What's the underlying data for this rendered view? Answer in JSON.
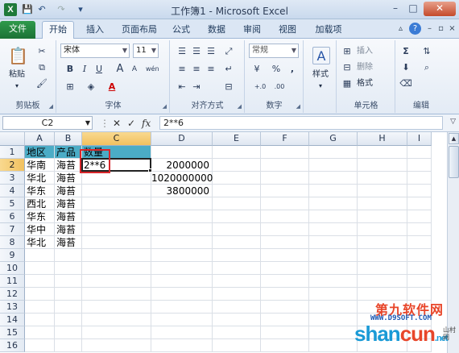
{
  "window": {
    "title": "工作簿1 - Microsoft Excel",
    "app_icon": "X",
    "qat_icons": [
      "save-icon",
      "undo-icon",
      "redo-icon",
      "customize-icon"
    ],
    "controls": [
      "–",
      "□",
      "✕"
    ]
  },
  "tabs": [
    {
      "label": "文件",
      "kind": "file"
    },
    {
      "label": "开始",
      "kind": "active"
    },
    {
      "label": "插入"
    },
    {
      "label": "页面布局"
    },
    {
      "label": "公式"
    },
    {
      "label": "数据"
    },
    {
      "label": "审阅"
    },
    {
      "label": "视图"
    },
    {
      "label": "加载项"
    }
  ],
  "ribbon": {
    "clipboard": {
      "label": "剪贴板",
      "paste": "粘贴"
    },
    "font": {
      "label": "字体",
      "font_name": "宋体",
      "font_size": "11",
      "bold": "B",
      "italic": "I",
      "underline": "U",
      "font_color": "A",
      "size_up": "A",
      "size_down": "A",
      "wen": "wén"
    },
    "alignment": {
      "label": "对齐方式"
    },
    "number": {
      "label": "数字",
      "format": "常规",
      "percent": "%",
      "comma": ","
    },
    "styles": {
      "label": "样式",
      "button": "样式"
    },
    "cells": {
      "label": "单元格",
      "insert": "插入",
      "delete": "删除",
      "format": "格式"
    },
    "editing": {
      "label": "编辑",
      "sigma": "Σ"
    }
  },
  "formula_bar": {
    "name_box": "C2",
    "cancel": "✕",
    "enter": "✓",
    "fx": "fx",
    "content": "2**6"
  },
  "grid": {
    "columns": [
      "A",
      "B",
      "C",
      "D",
      "E",
      "F",
      "G",
      "H",
      "I"
    ],
    "selected_column": "C",
    "rows": [
      "1",
      "2",
      "3",
      "4",
      "5",
      "6",
      "7",
      "8",
      "9",
      "10",
      "11",
      "12",
      "13",
      "14",
      "15",
      "16"
    ],
    "selected_row": "2",
    "header_fill_color": "#4bacc6",
    "cells": {
      "A1": "地区",
      "B1": "产品",
      "C1": "数量",
      "A2": "华南",
      "B2": "海苔",
      "C2": "2**6",
      "D2": "2000000",
      "A3": "华北",
      "B3": "海苔",
      "D3": "1020000000",
      "A4": "华东",
      "B4": "海苔",
      "D4": "3800000",
      "A5": "西北",
      "B5": "海苔",
      "A6": "华东",
      "B6": "海苔",
      "A7": "华中",
      "B7": "海苔",
      "A8": "华北",
      "B8": "海苔"
    }
  },
  "watermark": {
    "line1": "第九软件网",
    "line2": "WWW.D9SOFT.COM",
    "line3a": "shan",
    "line3b": "cun",
    "line3c": ".net",
    "line4": "山村网"
  }
}
